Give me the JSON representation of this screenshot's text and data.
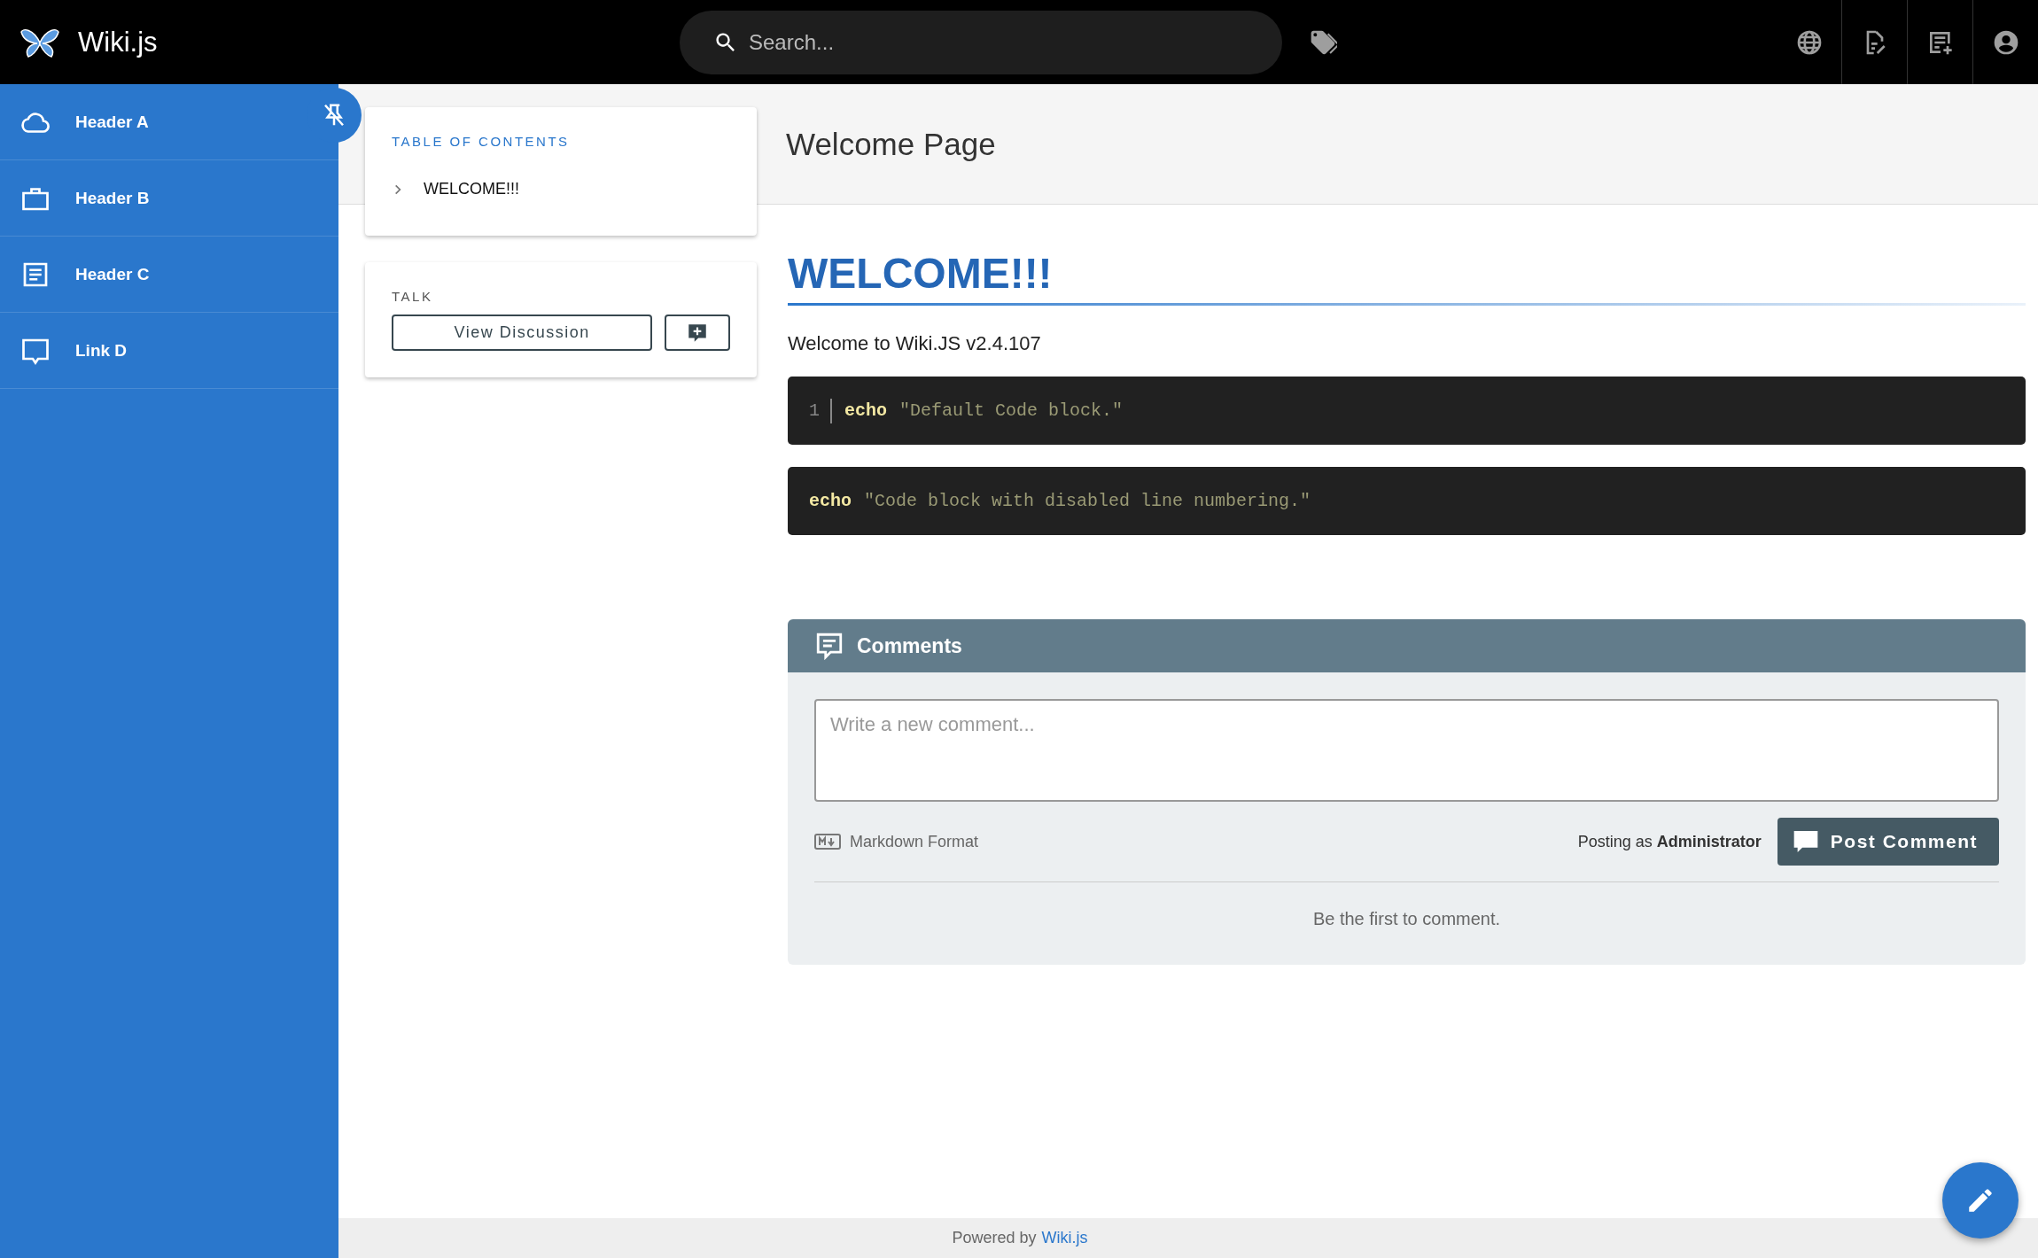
{
  "header": {
    "logo": "Wiki.js",
    "search": {
      "placeholder": "Search..."
    }
  },
  "sidebar": {
    "items": [
      {
        "label": "Header A"
      },
      {
        "label": "Header B"
      },
      {
        "label": "Header C"
      },
      {
        "label": "Link D"
      }
    ]
  },
  "toc": {
    "title": "TABLE OF CONTENTS",
    "items": [
      {
        "label": "WELCOME!!!"
      }
    ]
  },
  "talk": {
    "title": "TALK",
    "button": "View Discussion"
  },
  "page": {
    "title": "Welcome Page",
    "heading": "WELCOME!!!",
    "intro": "Welcome to Wiki.JS v2.4.107",
    "code_blocks": [
      {
        "line_numbers": true,
        "line_number": "1",
        "keyword": "echo",
        "string": "\"Default Code block.\""
      },
      {
        "line_numbers": false,
        "keyword": "echo",
        "string": "\"Code block with disabled line numbering.\""
      }
    ]
  },
  "comments": {
    "title": "Comments",
    "placeholder": "Write a new comment...",
    "format": "Markdown Format",
    "posting_as": "Posting as **Administrator**",
    "button": "Post Comment",
    "empty": "Be the first to comment."
  },
  "footer": {
    "text": "Powered by",
    "link": "Wiki.js"
  }
}
